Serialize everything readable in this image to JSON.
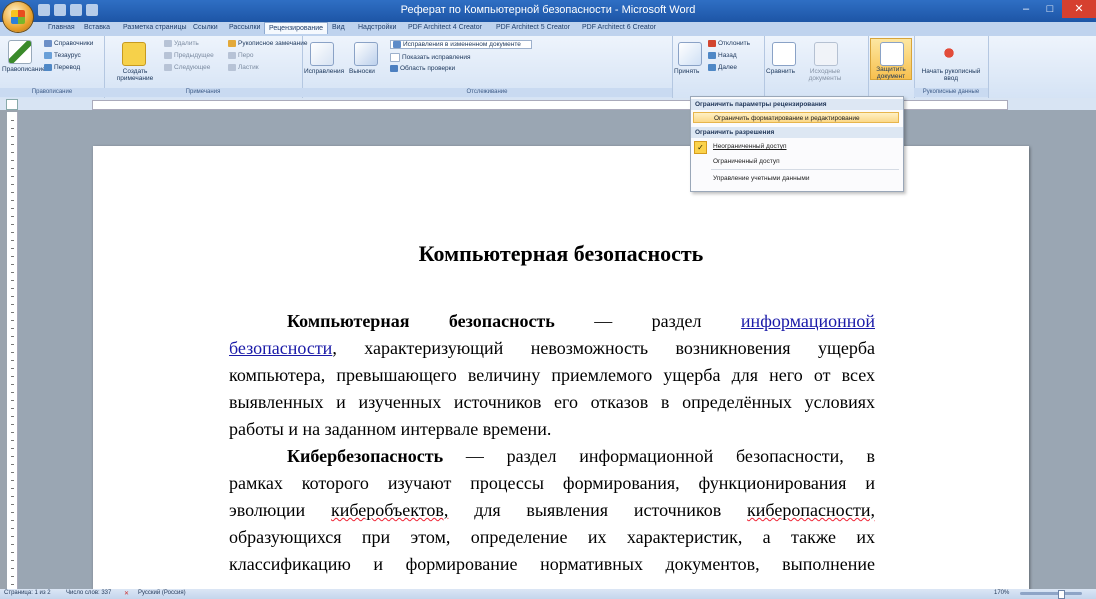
{
  "window": {
    "title": "Реферат по Компьютерной безопасности - Microsoft Word",
    "minimize": "–",
    "maximize": "□",
    "close": "✕"
  },
  "tabs": [
    "Главная",
    "Вставка",
    "Разметка страницы",
    "Ссылки",
    "Рассылки",
    "Рецензирование",
    "Вид",
    "Надстройки",
    "PDF Architect 4 Creator",
    "PDF Architect 5 Creator",
    "PDF Architect 6 Creator"
  ],
  "active_tab": "Рецензирование",
  "ribbon": {
    "proofing": {
      "label": "Правописание",
      "spelling": "Правописание",
      "research": "Справочники",
      "thesaurus": "Тезаурус",
      "translate": "Перевод"
    },
    "comments": {
      "label": "Примечания",
      "new": "Создать примечание",
      "delete": "Удалить",
      "previous": "Предыдущее",
      "next": "Следующее",
      "ink": "Рукописное замечание",
      "pen": "Перо",
      "eraser": "Ластик"
    },
    "tracking": {
      "label": "Отслеживание",
      "track_changes": "Исправления",
      "balloons": "Выноски",
      "display": "Исправления в измененном документе",
      "show_markup": "Показать исправления",
      "reviewing_pane": "Область проверки"
    },
    "changes": {
      "accept": "Принять",
      "reject": "Отклонить",
      "previous": "Назад",
      "next": "Далее"
    },
    "compare": {
      "compare": "Сравнить",
      "source": "Исходные документы"
    },
    "protect": {
      "protect_doc": "Защитить документ"
    },
    "ink": {
      "label": "Рукописные данные",
      "start": "Начать рукописный ввод"
    }
  },
  "menu": {
    "header1": "Ограничить параметры рецензирования",
    "item1": "Ограничить форматирование и редактирование",
    "header2": "Ограничить разрешения",
    "item2": "Неограниченный доступ",
    "item3": "Ограниченный доступ",
    "item4": "Управление учетными данными"
  },
  "document": {
    "title": "Компьютерная безопасность",
    "p1_l1_term": "Компьютерная безопасность",
    "p1_l1_dash": "—",
    "p1_l1_word": "раздел",
    "p1_l1_link": "информационной",
    "p1_l2_link": "безопасности",
    "p1_l2_rest": ", характеризующий невозможность возникновения ущерба",
    "p1_l3": "компьютера, превышающего величину приемлемого ущерба для него от всех",
    "p1_l4": "выявленных и изученных источников его отказов в определённых условиях",
    "p1_l5": "работы и на заданном интервале времени.",
    "p2_l1_term": "Кибербезопасность",
    "p2_l1_rest": "— раздел информационной безопасности, в",
    "p2_l2": "рамках которого изучают процессы формирования, функционирования и",
    "p2_l3_a": "эволюции",
    "p2_l3_b": "киберобъектов,",
    "p2_l3_c": "для выявления источников",
    "p2_l3_d": "киберопасности,",
    "p2_l4": "образующихся при этом, определение их характеристик, а также их",
    "p2_l5": "классификацию и формирование нормативных документов, выполнение"
  },
  "status": {
    "page": "Страница: 1 из 2",
    "words": "Число слов: 337",
    "language": "Русский (Россия)",
    "zoom": "170%"
  }
}
